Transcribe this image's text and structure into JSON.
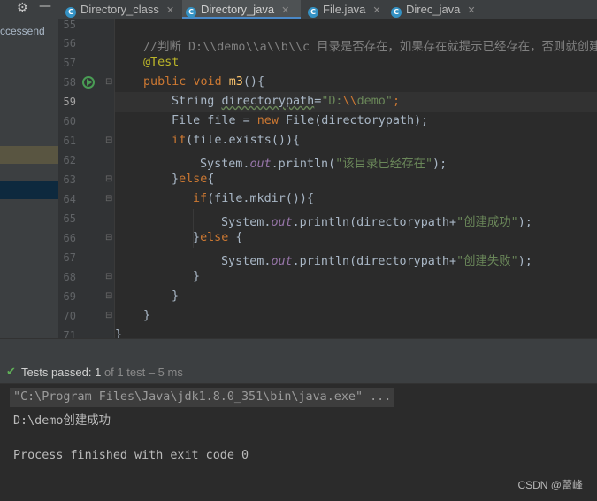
{
  "tabs": [
    {
      "label": "Directory_class",
      "active": false
    },
    {
      "label": "Directory_java",
      "active": true
    },
    {
      "label": "File.java",
      "active": false
    },
    {
      "label": "Direc_java",
      "active": false
    }
  ],
  "toolbar": {
    "settings_icon": "gear-icon",
    "minimize_icon": "minimize-icon"
  },
  "left_panel": {
    "text": "ccessend"
  },
  "gutter": {
    "line_numbers": [
      "55",
      "56",
      "57",
      "58",
      "59",
      "60",
      "61",
      "62",
      "63",
      "64",
      "65",
      "66",
      "67",
      "68",
      "69",
      "70",
      "71"
    ],
    "current_line": "59"
  },
  "code": {
    "l55": "",
    "l56_comment": "//判断 D:\\\\demo\\\\a\\\\b\\\\c 目录是否存在，如果存在就提示已经存在，否则就创建",
    "l57_annotation": "@Test",
    "l58_kw": "public void ",
    "l58_fn": "m3",
    "l58_rest": "(){",
    "l59_type": "String ",
    "l59_var": "directorypath",
    "l59_eq": "=",
    "l59_str1": "\"D:",
    "l59_esc": "\\\\",
    "l59_str2": "demo\"",
    "l59_end": ";",
    "l60_a": "File file = ",
    "l60_kw": "new ",
    "l60_b": "File(directorypath);",
    "l61_kw": "if",
    "l61_rest": "(file.exists()){",
    "l62_a": "System.",
    "l62_out": "out",
    "l62_b": ".println(",
    "l62_str": "\"该目录已经存在\"",
    "l62_c": ");",
    "l63_a": "}",
    "l63_kw": "else",
    "l63_b": "{",
    "l64_kw": "if",
    "l64_rest": "(file.mkdir()){",
    "l65_a": "System.",
    "l65_out": "out",
    "l65_b": ".println(directorypath+",
    "l65_str": "\"创建成功\"",
    "l65_c": ");",
    "l66_a": "}",
    "l66_kw": "else ",
    "l66_b": "{",
    "l67_a": "System.",
    "l67_out": "out",
    "l67_b": ".println(directorypath+",
    "l67_str": "\"创建失败\"",
    "l67_c": ");",
    "l68": "}",
    "l69": "}",
    "l70": "}",
    "l71": "}"
  },
  "run_status": {
    "prefix": "Tests passed: ",
    "count": "1",
    "suffix": " of 1 test – 5 ms"
  },
  "console": {
    "command": "\"C:\\Program Files\\Java\\jdk1.8.0_351\\bin\\java.exe\" ...",
    "output": "D:\\demo创建成功",
    "exit": "Process finished with exit code 0"
  },
  "watermark": "CSDN @蕾峰"
}
